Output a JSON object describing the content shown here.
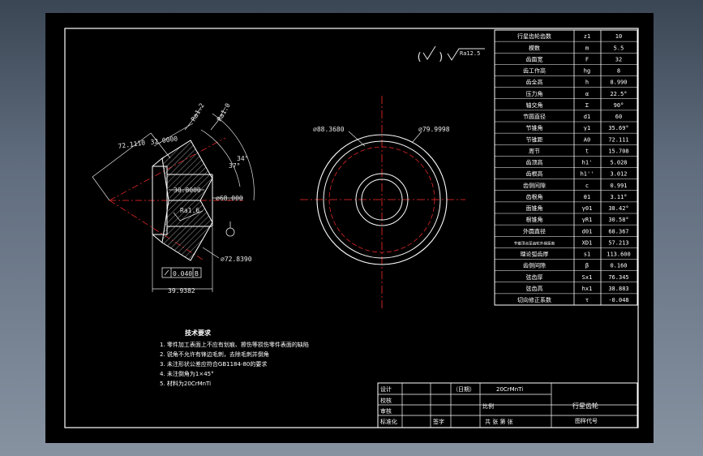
{
  "surface": {
    "ra_label": "Ra12.5"
  },
  "left_view": {
    "dim_72_11": "72.1110",
    "dim_32": "32.0000",
    "ra_top_1": "Ra1.2",
    "ra_top_2": "Ra1.0",
    "dim_30_8": "30.8000",
    "dim_phi68": "⌀68.000",
    "angle_34": "34°",
    "angle_37": "37°",
    "ra_mid": "Ra1.6",
    "dim_phi72": "⌀72.8390",
    "tol_value": "0.040",
    "tol_datum": "B",
    "dim_39": "39.9382"
  },
  "right_view": {
    "dim_phi88": "⌀88.3680",
    "dim_phi79": "⌀79.9998"
  },
  "param_table": {
    "rows": [
      [
        "行星齿轮齿数",
        "z1",
        "10"
      ],
      [
        "模数",
        "m",
        "5.5"
      ],
      [
        "齿面宽",
        "F",
        "32"
      ],
      [
        "齿工作高",
        "hg",
        "8"
      ],
      [
        "齿全高",
        "h",
        "8.990"
      ],
      [
        "压力角",
        "α",
        "22.5°"
      ],
      [
        "轴交角",
        "Σ",
        "90°"
      ],
      [
        "节圆直径",
        "d1",
        "60"
      ],
      [
        "节锥角",
        "γ1",
        "35.69°"
      ],
      [
        "节锥距",
        "A0",
        "72.111"
      ],
      [
        "周节",
        "t",
        "15.708"
      ],
      [
        "齿顶高",
        "h1'",
        "5.028"
      ],
      [
        "齿根高",
        "h1''",
        "3.012"
      ],
      [
        "齿侧间隙",
        "c",
        "0.991"
      ],
      [
        "齿根角",
        "θ1",
        "3.11°"
      ],
      [
        "面锥角",
        "γ01",
        "38.42°"
      ],
      [
        "根锥角",
        "γR1",
        "30.58°"
      ],
      [
        "外圆直径",
        "d01",
        "68.367"
      ],
      [
        "节锥顶点至齿轮外缘距离",
        "XD1",
        "57.213"
      ],
      [
        "理论弧齿厚",
        "s1",
        "113.600"
      ],
      [
        "齿侧间隙",
        "β",
        "0.160"
      ],
      [
        "弦齿厚",
        "Sx1",
        "76.345"
      ],
      [
        "弦齿高",
        "hx1",
        "38.883"
      ],
      [
        "切向修正系数",
        "τ",
        "-0.048"
      ]
    ]
  },
  "tech_req": {
    "title": "技术要求",
    "items": [
      "1. 零件加工表面上不应有划痕、擦伤等损伤零件表面的缺陷",
      "2. 锐角不允许有锋边毛刺，去除毛刺并倒角",
      "3. 未注形状公差应符合GB1184-80的要求",
      "4. 未注倒角为1×45°",
      "5. 材料为20CrMnTi"
    ]
  },
  "title_block": {
    "design": "设计",
    "check": "校核",
    "review": "审核",
    "std": "标准化",
    "date": "（日期）",
    "sign": "签字",
    "material": "20CrMnTi",
    "scale": "比例",
    "part_name": "行星齿轮",
    "sheets": "共    张  第    张",
    "drawing_no": "图样代号"
  }
}
